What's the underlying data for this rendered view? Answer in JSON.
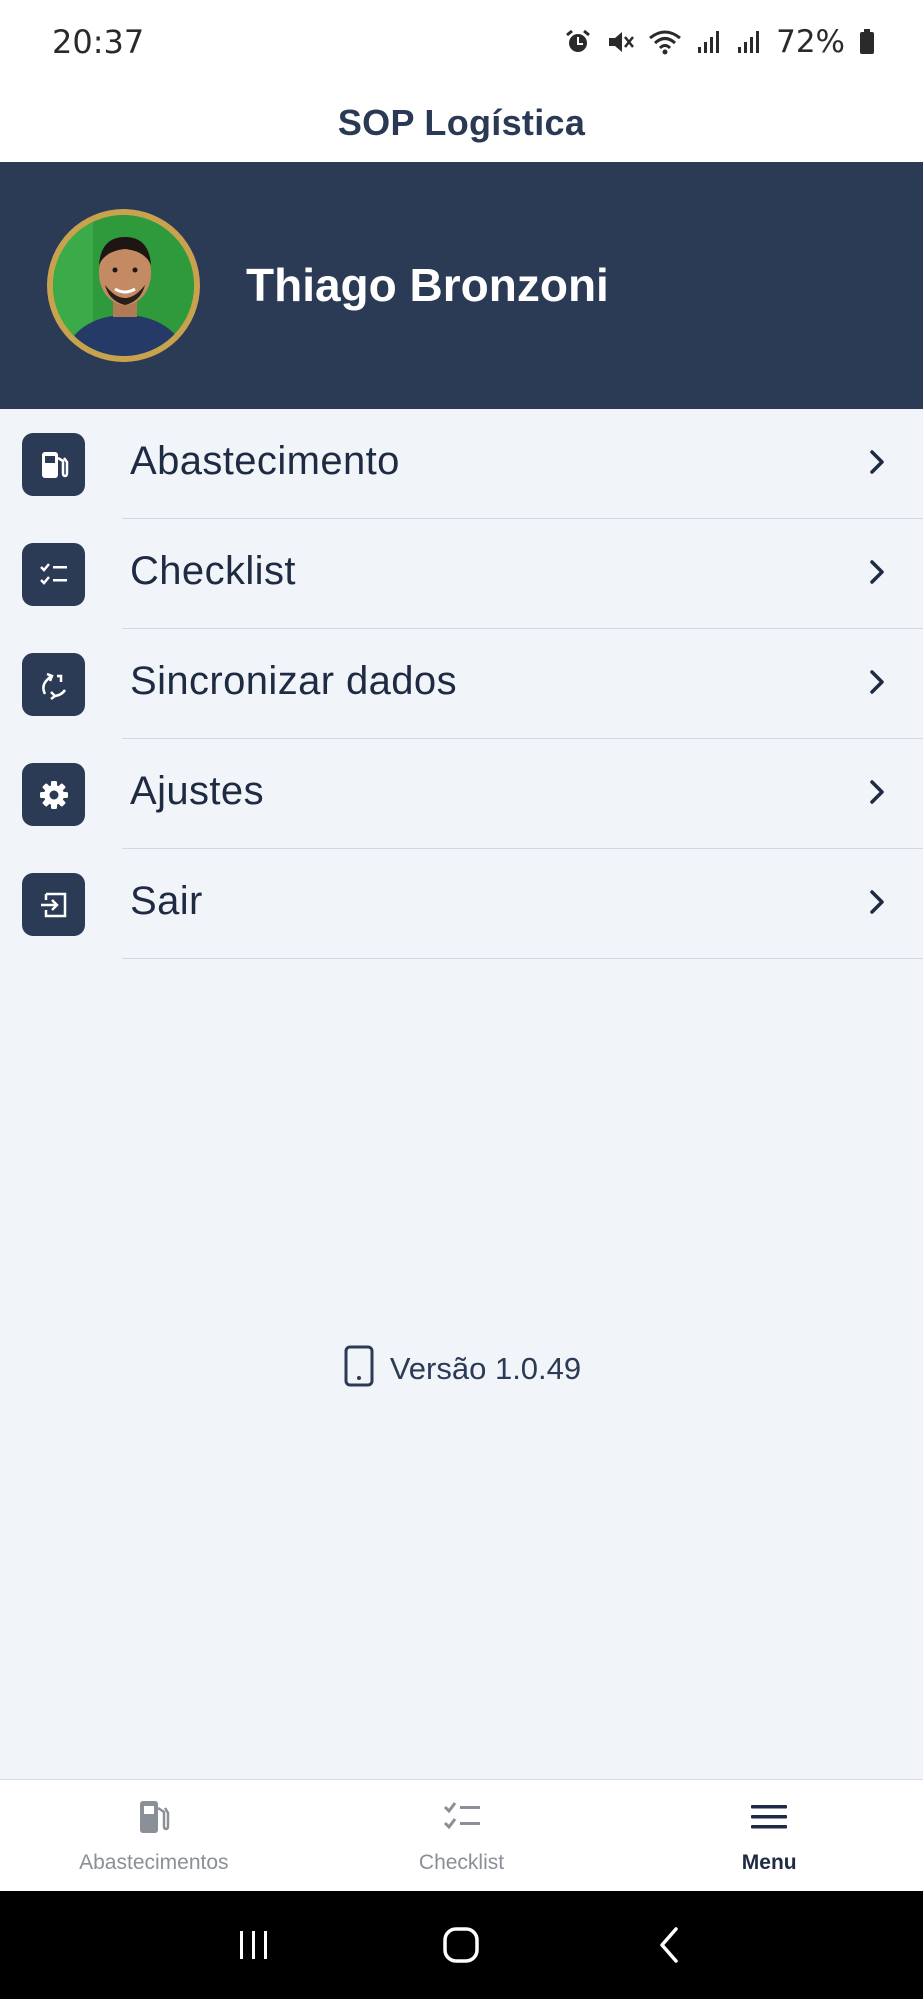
{
  "status_bar": {
    "time": "20:37",
    "battery": "72%",
    "icons": [
      "alarm-icon",
      "mute-icon",
      "wifi-icon",
      "signal-icon",
      "signal-icon",
      "battery-icon"
    ]
  },
  "app": {
    "title": "SOP Logística"
  },
  "profile": {
    "name": "Thiago Bronzoni",
    "avatar_icon": "avatar-photo"
  },
  "menu": {
    "items": [
      {
        "label": "Abastecimento",
        "icon": "fuel-pump-icon"
      },
      {
        "label": "Checklist",
        "icon": "checklist-icon"
      },
      {
        "label": "Sincronizar dados",
        "icon": "sync-icon"
      },
      {
        "label": "Ajustes",
        "icon": "gear-icon"
      },
      {
        "label": "Sair",
        "icon": "logout-icon"
      }
    ]
  },
  "version": {
    "text": "Versão 1.0.49",
    "icon": "phone-icon"
  },
  "bottom_nav": {
    "items": [
      {
        "label": "Abastecimentos",
        "icon": "fuel-pump-icon",
        "active": false
      },
      {
        "label": "Checklist",
        "icon": "checklist-icon",
        "active": false
      },
      {
        "label": "Menu",
        "icon": "hamburger-menu-icon",
        "active": true
      }
    ]
  },
  "colors": {
    "primary": "#2B3A55",
    "background": "#F1F5FA",
    "avatar_ring": "#C9A24D",
    "inactive": "#8A8F98"
  }
}
